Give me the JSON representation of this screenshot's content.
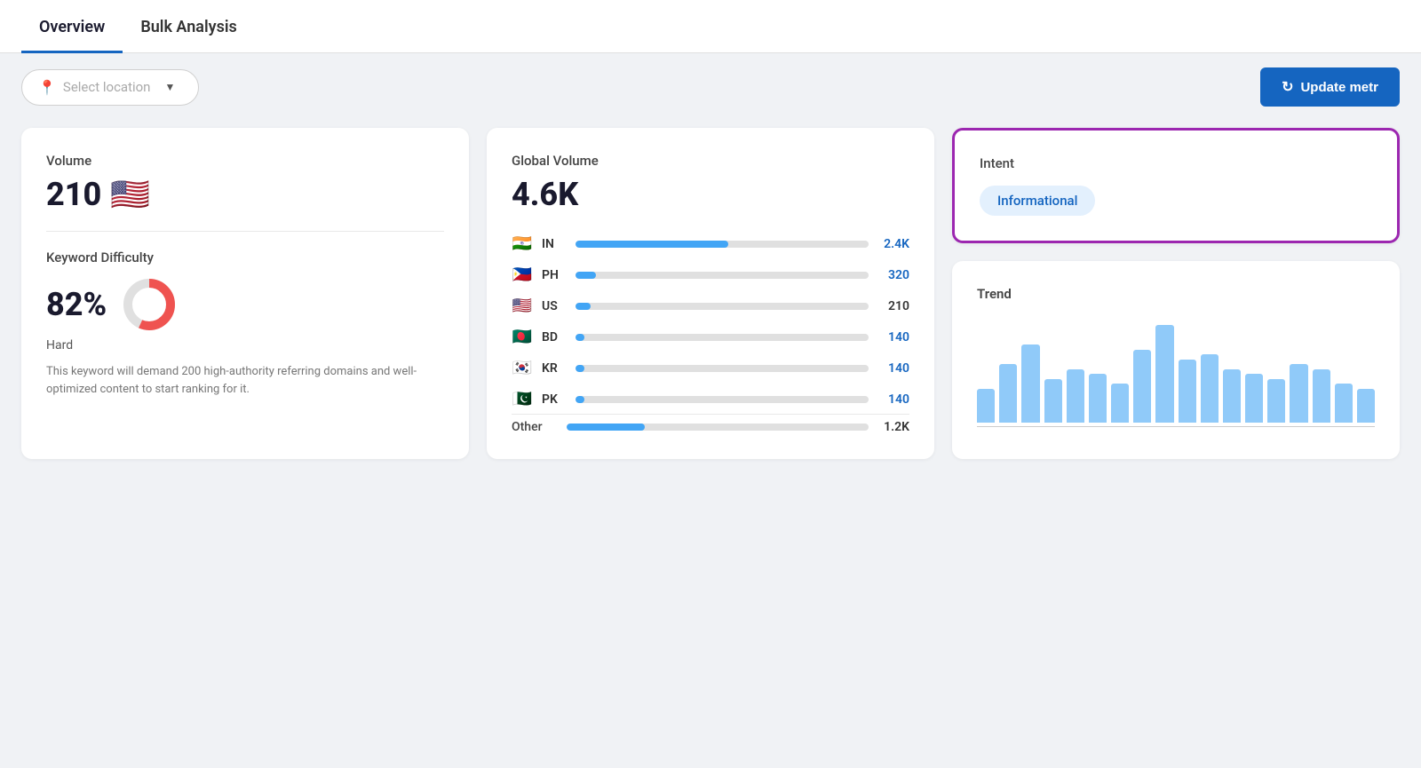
{
  "tabs": [
    {
      "id": "overview",
      "label": "Overview",
      "active": true
    },
    {
      "id": "bulk-analysis",
      "label": "Bulk Analysis",
      "active": false
    }
  ],
  "toolbar": {
    "location_placeholder": "Select location",
    "update_button_label": "Update metr"
  },
  "volume_card": {
    "label": "Volume",
    "value": "210",
    "flag": "🇺🇸",
    "kd_label": "Keyword Difficulty",
    "kd_percent": "82%",
    "kd_difficulty": "Hard",
    "kd_description": "This keyword will demand 200 high-authority referring domains and well-optimized content to start ranking for it.",
    "donut_filled": 82,
    "donut_color": "#ef5350",
    "donut_bg": "#e0e0e0"
  },
  "global_volume_card": {
    "label": "Global Volume",
    "value": "4.6K",
    "countries": [
      {
        "flag": "🇮🇳",
        "code": "IN",
        "bar_pct": 52,
        "value": "2.4K",
        "colored": true
      },
      {
        "flag": "🇵🇭",
        "code": "PH",
        "bar_pct": 7,
        "value": "320",
        "colored": true
      },
      {
        "flag": "🇺🇸",
        "code": "US",
        "bar_pct": 5,
        "value": "210",
        "colored": false
      },
      {
        "flag": "🇧🇩",
        "code": "BD",
        "bar_pct": 3,
        "value": "140",
        "colored": true
      },
      {
        "flag": "🇰🇷",
        "code": "KR",
        "bar_pct": 3,
        "value": "140",
        "colored": true
      },
      {
        "flag": "🇵🇰",
        "code": "PK",
        "bar_pct": 3,
        "value": "140",
        "colored": true
      }
    ],
    "other_label": "Other",
    "other_bar_pct": 26,
    "other_value": "1.2K"
  },
  "intent_card": {
    "label": "Intent",
    "badge": "Informational",
    "border_color": "#9c27b0"
  },
  "trend_card": {
    "label": "Trend",
    "bars": [
      35,
      60,
      80,
      45,
      55,
      50,
      40,
      75,
      100,
      65,
      70,
      55,
      50,
      45,
      60,
      55,
      40,
      35
    ]
  }
}
